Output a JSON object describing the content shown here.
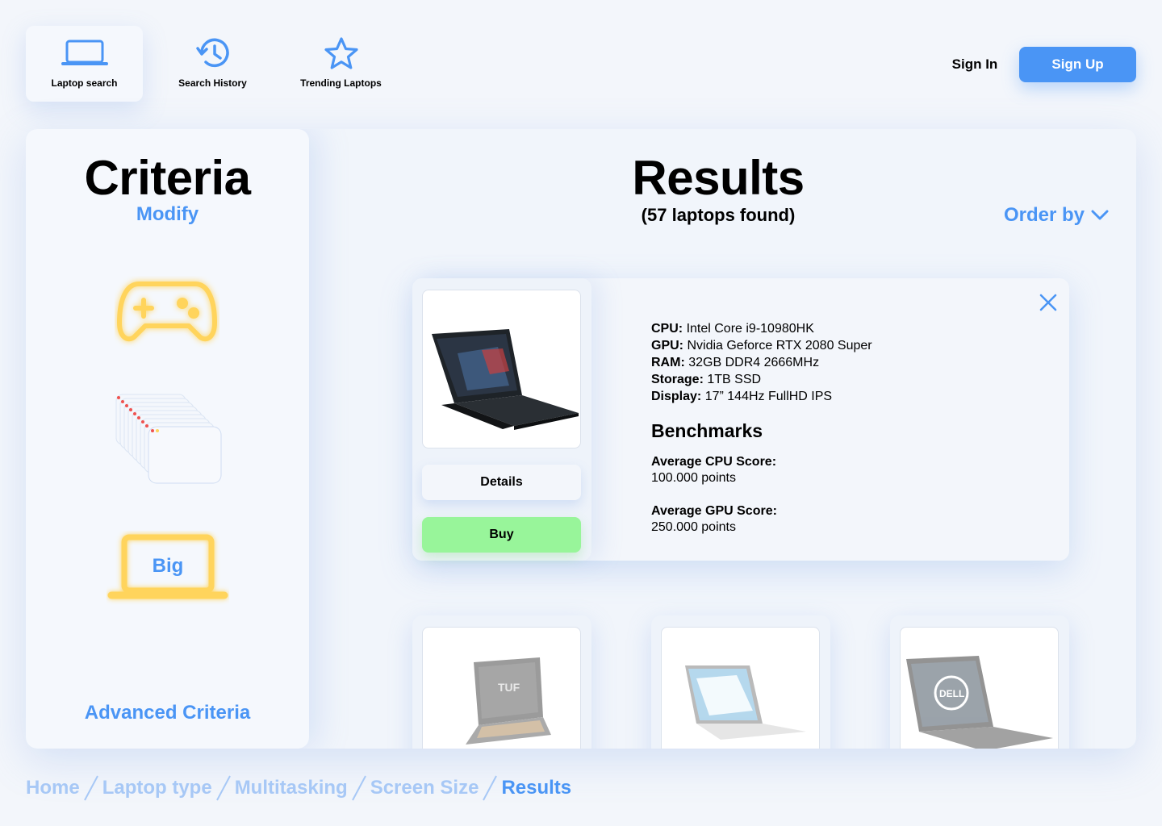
{
  "nav": {
    "items": [
      {
        "label": "Laptop search",
        "icon": "laptop-icon",
        "active": true
      },
      {
        "label": "Search History",
        "icon": "history-icon",
        "active": false
      },
      {
        "label": "Trending Laptops",
        "icon": "star-icon",
        "active": false
      }
    ],
    "sign_in": "Sign In",
    "sign_up": "Sign Up"
  },
  "criteria": {
    "title": "Criteria",
    "modify": "Modify",
    "icons": [
      "gamepad-icon",
      "windows-stack-icon",
      "big-screen-icon"
    ],
    "screen_size_label": "Big",
    "advanced": "Advanced Criteria"
  },
  "results": {
    "title": "Results",
    "count": "(57 laptops found)",
    "order_by": "Order by"
  },
  "expanded_card": {
    "specs": [
      {
        "label": "CPU:",
        "value": "Intel Core i9-10980HK"
      },
      {
        "label": "GPU:",
        "value": "Nvidia Geforce RTX 2080 Super"
      },
      {
        "label": "RAM:",
        "value": "32GB DDR4 2666MHz"
      },
      {
        "label": "Storage:",
        "value": "1TB SSD"
      },
      {
        "label": "Display:",
        "value": "17” 144Hz FullHD IPS"
      }
    ],
    "benchmarks_title": "Benchmarks",
    "benchmarks": [
      {
        "label": "Average CPU Score:",
        "value": "100.000 points"
      },
      {
        "label": "Average GPU Score:",
        "value": "250.000 points"
      }
    ],
    "details_label": "Details",
    "buy_label": "Buy"
  },
  "other_results": [
    "asus-tuf-laptop-image",
    "dell-xps-laptop-image",
    "dell-laptop-image"
  ],
  "breadcrumb": [
    {
      "label": "Home",
      "current": false
    },
    {
      "label": "Laptop type",
      "current": false
    },
    {
      "label": "Multitasking",
      "current": false
    },
    {
      "label": "Screen Size",
      "current": false
    },
    {
      "label": "Results",
      "current": true
    }
  ],
  "colors": {
    "accent": "#4a95f5",
    "buy": "#98f59a",
    "criteria_icon": "#ffd45c",
    "crumb_inactive": "#a7c8f6"
  }
}
